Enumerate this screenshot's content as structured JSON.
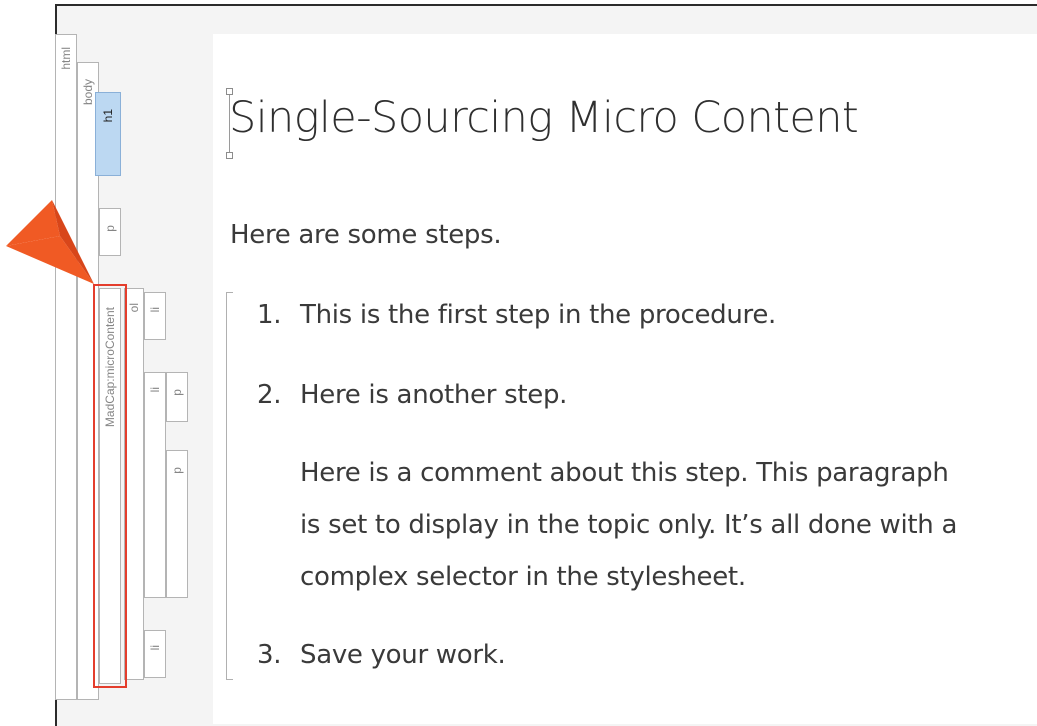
{
  "structure_bar": {
    "html_tag": "html",
    "body_tag": "body",
    "h1_tag": "h1",
    "p_tag": "p",
    "microcontent_tag": "MadCap:microContent",
    "ol_tag": "ol",
    "li_tag": "li"
  },
  "content": {
    "title": "Single-Sourcing Micro Content",
    "intro": "Here are some steps.",
    "steps": [
      {
        "number": "1.",
        "text": "This is the first step in the procedure."
      },
      {
        "number": "2.",
        "text": "Here is another step."
      },
      {
        "number": "3.",
        "text": "Save your work."
      }
    ],
    "comment_lines": [
      "Here is a comment about this step. This paragraph",
      "is set to display in the topic only. It’s all done with a",
      "complex selector in the stylesheet."
    ]
  },
  "colors": {
    "callout": "#f05a24",
    "highlight_border": "#e43d2c",
    "h1_fill": "#bcd8f2"
  }
}
